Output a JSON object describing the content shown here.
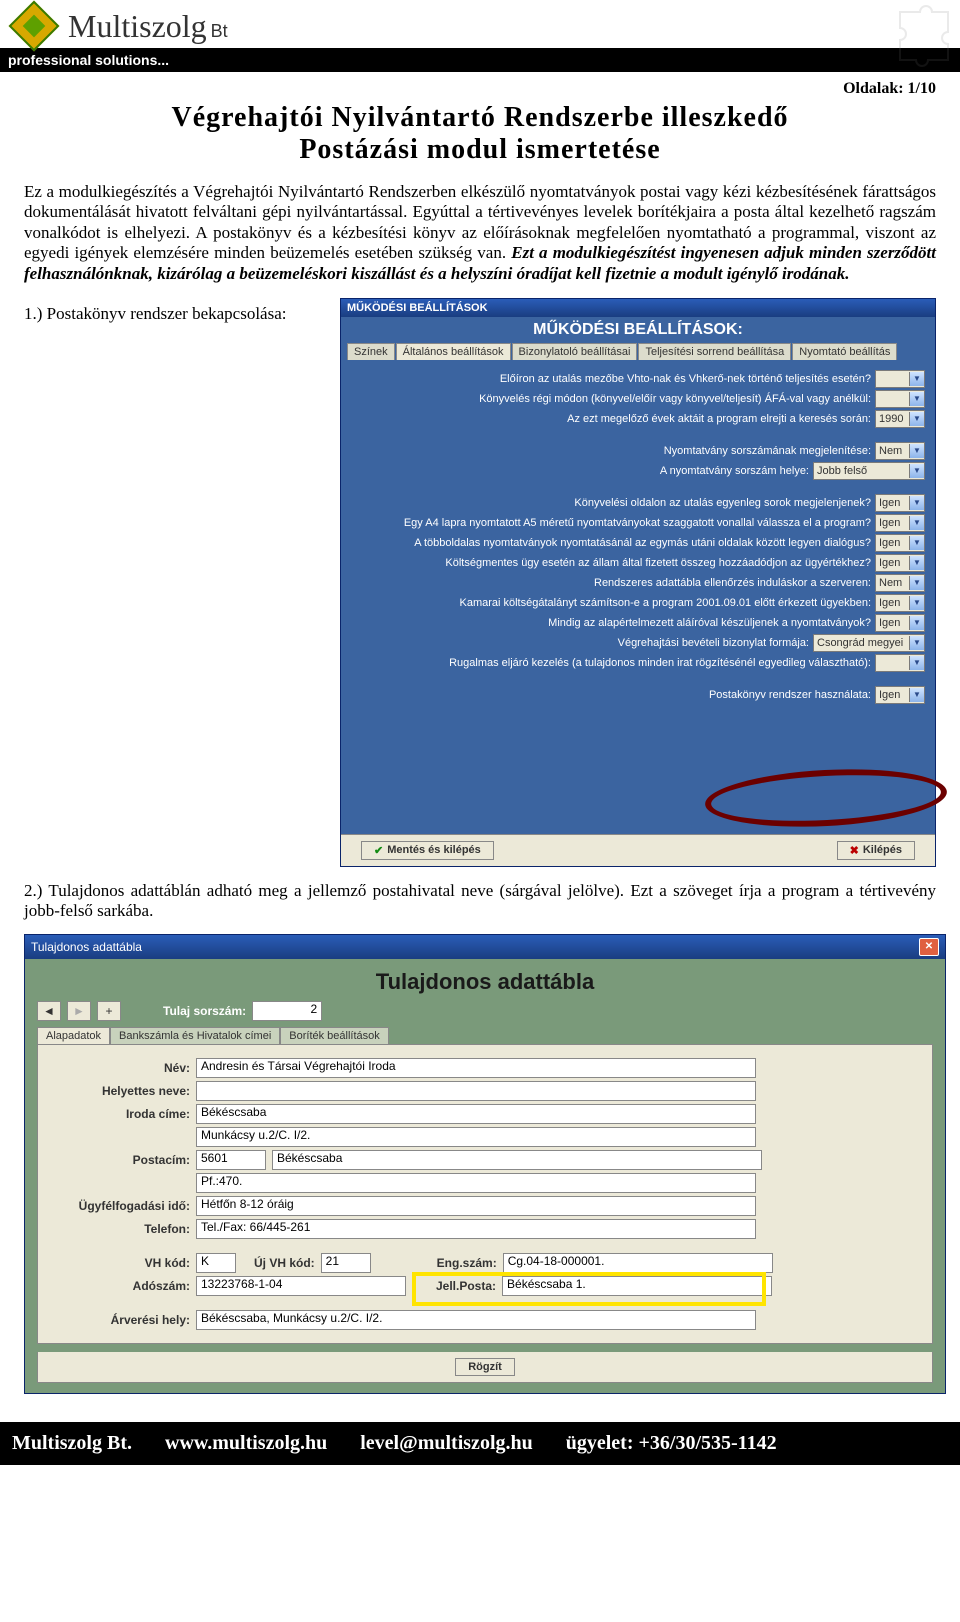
{
  "header": {
    "brand": "Multiszolg",
    "brand_suffix": "Bt",
    "tagline": "professional solutions..."
  },
  "page": {
    "page_num": "Oldalak: 1/10",
    "title_line1": "Végrehajtói Nyilvántartó Rendszerbe illeszkedő",
    "title_line2": "Postázási modul ismertetése",
    "para1": "Ez a modulkiegészítés a Végrehajtói Nyilvántartó Rendszerben elkészülő nyomtatványok postai vagy kézi kézbesítésének fárattságos dokumentálását hivatott felváltani gépi nyilvántartással. Egyúttal a tértivevényes levelek borítékjaira a posta által kezelhető ragszám vonalkódot is elhelyezi. A postakönyv és a kézbesítési könyv az előírásoknak megfelelően nyomtatható a programmal, viszont az egyedi igények elemzésére minden beüzemelés esetében szükség van. ",
    "para1_bold": "Ezt a modulkiegészítést ingyenesen adjuk minden szerződött felhasználónknak, kizárólag a beüzemeléskori kiszállást és a helyszíni óradíjat kell fizetnie a modult igénylő irodának.",
    "section1": "1.) Postakönyv rendszer bekapcsolása:",
    "section2": "2.) Tulajdonos adattáblán adható meg a jellemző postahivatal neve (sárgával jelölve). Ezt a szöveget írja a program a tértivevény jobb-felső sarkába."
  },
  "dlg1": {
    "title": "MŰKÖDÉSI BEÁLLÍTÁSOK",
    "subtitle": "MŰKÖDÉSI BEÁLLÍTÁSOK:",
    "tabs": [
      "Színek",
      "Általános beállítások",
      "Bizonylatoló beállításai",
      "Teljesítési sorrend beállítása",
      "Nyomtató beállítás"
    ],
    "rows": [
      {
        "label": "Előíron az utalás mezőbe Vhto-nak és Vhkerő-nek történő teljesítés esetén?",
        "val": ""
      },
      {
        "label": "Könyvelés régi módon (könyvel/előír vagy könyvel/teljesít) ÁFÁ-val vagy anélkül:",
        "val": ""
      },
      {
        "label": "Az ezt megelőző évek aktáit a program elrejti a keresés során:",
        "val": "1990"
      },
      {
        "label": "Nyomtatvány sorszámának megjelenítése:",
        "val": "Nem"
      },
      {
        "label": "A nyomtatvány sorszám helye:",
        "val": "Jobb felső"
      },
      {
        "label": "Könyvelési oldalon az utalás egyenleg sorok megjelenjenek?",
        "val": "Igen"
      },
      {
        "label": "Egy A4 lapra nyomtatott A5 méretű nyomtatványokat szaggatott vonallal válassza el a program?",
        "val": "Igen"
      },
      {
        "label": "A többoldalas nyomtatványok nyomtatásánál az egymás utáni oldalak között legyen dialógus?",
        "val": "Igen"
      },
      {
        "label": "Költségmentes ügy esetén az állam által fizetett összeg hozzáadódjon az ügyértékhez?",
        "val": "Igen"
      },
      {
        "label": "Rendszeres adattábla ellenőrzés induláskor a szerveren:",
        "val": "Nem"
      },
      {
        "label": "Kamarai költségátalányt számítson-e a program 2001.09.01 előtt érkezett ügyekben:",
        "val": "Igen"
      },
      {
        "label": "Mindig az alapértelmezett aláíróval készüljenek a nyomtatványok?",
        "val": "Igen"
      },
      {
        "label": "Végrehajtási bevételi bizonylat formája:",
        "val": "Csongrád megyei"
      },
      {
        "label": "Rugalmas eljáró kezelés (a tulajdonos minden irat rögzítésénél egyedileg választható):",
        "val": ""
      },
      {
        "label": "Postakönyv rendszer használata:",
        "val": "Igen"
      }
    ],
    "save_btn": "Mentés és kilépés",
    "exit_btn": "Kilépés"
  },
  "dlg2": {
    "title": "Tulajdonos adattábla",
    "big": "Tulajdonos adattábla",
    "sorszam_label": "Tulaj sorszám:",
    "sorszam_val": "2",
    "tabs": [
      "Alapadatok",
      "Bankszámla és Hivatalok címei",
      "Boríték beállítások"
    ],
    "fields": {
      "nev_l": "Név:",
      "nev": "Andresin és Társai Végrehajtói Iroda",
      "hely_l": "Helyettes neve:",
      "iroda_l": "Iroda címe:",
      "iroda": "Békéscsaba",
      "munkacsy": "Munkácsy u.2/C. I/2.",
      "posta_l": "Postacím:",
      "posta_irsz": "5601",
      "posta_varos": "Békéscsaba",
      "pf": "Pf.:470.",
      "ugyf_l": "Ügyfélfogadási idő:",
      "ugyf": "Hétfőn 8-12 óráig",
      "tel_l": "Telefon:",
      "tel": "Tel./Fax: 66/445-261",
      "vhkod_l": "VH kód:",
      "vhkod": "K",
      "ujvh_l": "Új VH kód:",
      "ujvh": "21",
      "eng_l": "Eng.szám:",
      "eng": "Cg.04-18-000001.",
      "ado_l": "Adószám:",
      "ado": "13223768-1-04",
      "jell_l": "Jell.Posta:",
      "jell": "Békéscsaba 1.",
      "arv_l": "Árverési hely:",
      "arv": "Békéscsaba, Munkácsy u.2/C. I/2."
    },
    "rogzit_btn": "Rögzít"
  },
  "footer": {
    "company": "Multiszolg Bt.",
    "web": "www.multiszolg.hu",
    "email": "level@multiszolg.hu",
    "phone": "ügyelet: +36/30/535-1142"
  }
}
